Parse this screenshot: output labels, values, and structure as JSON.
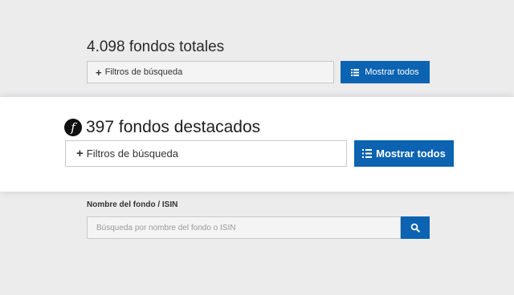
{
  "top_section": {
    "title": "4.098 fondos totales",
    "filter_label": "Filtros de búsqueda",
    "show_all_label": "Mostrar todos"
  },
  "highlight_section": {
    "badge_glyph": "f",
    "title": "397 fondos destacados",
    "filter_label": "Filtros de búsqueda",
    "show_all_label": "Mostrar todos"
  },
  "search": {
    "label": "Nombre del fondo / ISIN",
    "placeholder": "Búsqueda por nombre del fondo o ISIN"
  },
  "icons": {
    "filter": "plus-icon",
    "show_all": "list-icon",
    "search": "search-icon",
    "badge": "fund-logo-icon"
  },
  "colors": {
    "accent": "#0b63b1",
    "background": "#ececed",
    "band": "#ffffff"
  }
}
